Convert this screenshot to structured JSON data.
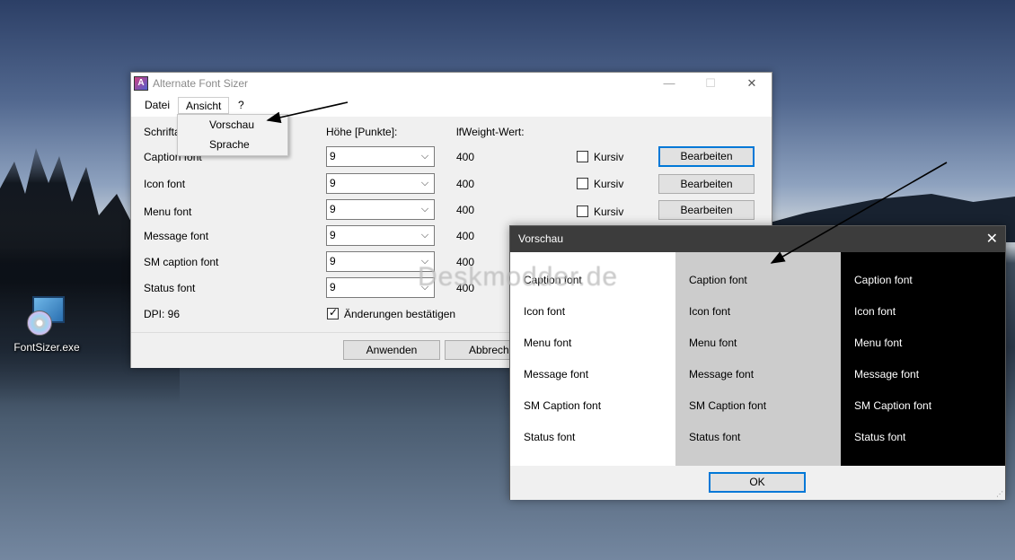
{
  "desktop": {
    "icon_label": "FontSizer.exe"
  },
  "window": {
    "title": "Alternate Font Sizer",
    "minimize": "—",
    "maximize": "☐",
    "close": "✕"
  },
  "menubar": {
    "items": [
      "Datei",
      "Ansicht",
      "?"
    ]
  },
  "menu_dropdown": {
    "items": [
      "Vorschau",
      "Sprache"
    ]
  },
  "headers": {
    "font": "Schrifta",
    "height": "Höhe [Punkte]:",
    "weight": "lfWeight-Wert:"
  },
  "rows": [
    {
      "label": "Caption font",
      "size": "9",
      "weight": "400",
      "italic_label": "Kursiv",
      "button": "Bearbeiten"
    },
    {
      "label": "Icon font",
      "size": "9",
      "weight": "400",
      "italic_label": "Kursiv",
      "button": "Bearbeiten"
    },
    {
      "label": "Menu font",
      "size": "9",
      "weight": "400",
      "italic_label": "Kursiv",
      "button": "Bearbeiten"
    },
    {
      "label": "Message font",
      "size": "9",
      "weight": "400"
    },
    {
      "label": "SM caption font",
      "size": "9",
      "weight": "400"
    },
    {
      "label": "Status font",
      "size": "9",
      "weight": "400"
    }
  ],
  "dpi": "DPI: 96",
  "confirm_label": "Änderungen bestätigen",
  "footer": {
    "apply": "Anwenden",
    "cancel": "Abbrech"
  },
  "preview": {
    "title": "Vorschau",
    "close": "✕",
    "fonts": [
      "Caption font",
      "Icon font",
      "Menu font",
      "Message font",
      "SM Caption font",
      "Status font"
    ],
    "ok": "OK"
  },
  "watermark": "Deskmodder.de"
}
